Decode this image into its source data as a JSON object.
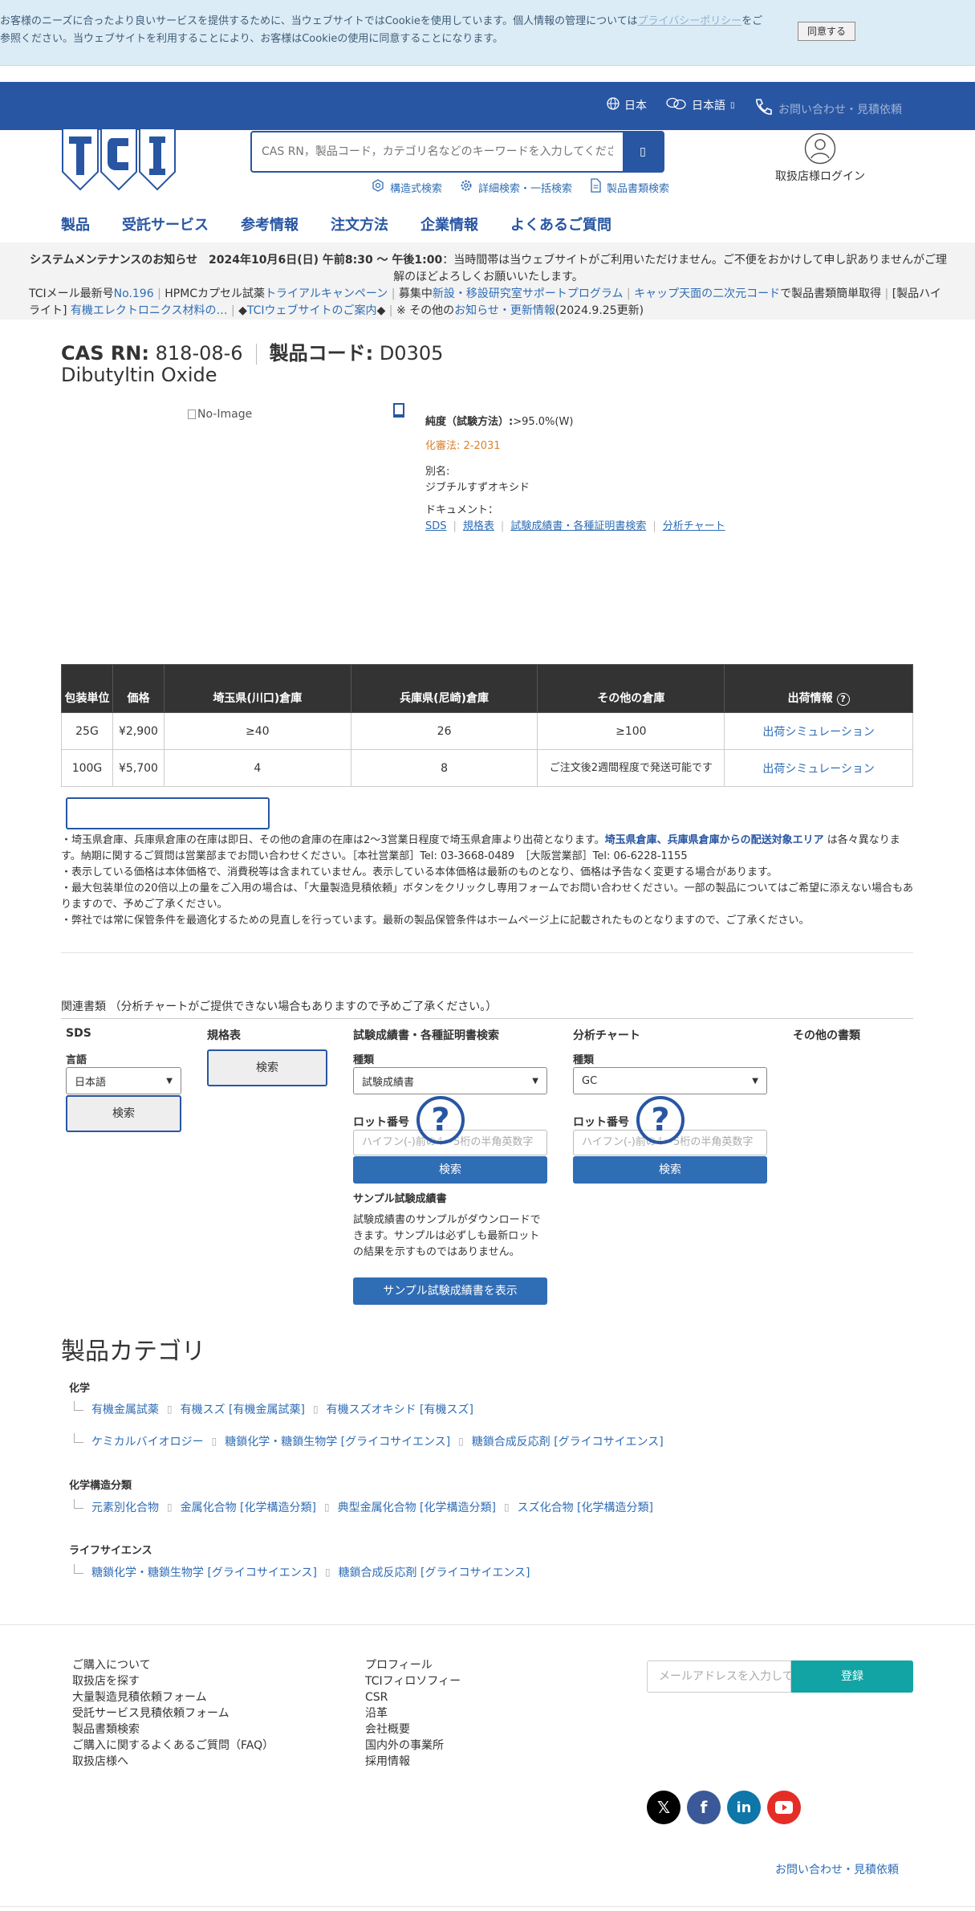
{
  "cookie": {
    "message_part1": "お客様のニーズに合ったより良いサービスを提供するために、当ウェブサイトではCookieを使用しています。個人情報の管理については",
    "privacy_link": "プライバシーポリシー",
    "message_part2": "をご参照ください。当ウェブサイトを利用することにより、お客様はCookieの使用に同意することになります。",
    "agree_label": "同意する"
  },
  "topbar": {
    "country": "日本",
    "language": "日本語",
    "contact": "お問い合わせ・見積依頼"
  },
  "header": {
    "search_placeholder": "CAS RN，製品コード，カテゴリ名などのキーワードを入力してください",
    "structure_search": "構造式検索",
    "advanced_search": "詳細検索・一括検索",
    "catalog_search": "製品書類検索",
    "login_label": "取扱店様ログイン"
  },
  "nav": [
    "製品",
    "受託サービス",
    "参考情報",
    "注文方法",
    "企業情報",
    "よくあるご質問"
  ],
  "notice": {
    "line1_bold": "システムメンテナンスのお知らせ　2024年10月6日(日) 午前8:30 〜 午後1:00",
    "line1_rest": "：当時間帯は当ウェブサイトがご利用いただけません。ご不便をおかけして申し訳ありませんがご理解のほどよろしくお願いいたします。",
    "line2_prefix": "TCIメール最新号",
    "line2_no": "No.196",
    "line2_a": "HPMCカプセル試薬",
    "line2_a_link": "トライアルキャンペーン",
    "line2_b": "募集中",
    "line2_b_link": "新設・移設研究室サポートプログラム",
    "line2_c_link": "キャップ天面の二次元コード",
    "line2_c": "で製品書類簡単取得",
    "line2_d": "[製品ハイライト]",
    "line2_d_link": "有機エレクトロニクス材料の…",
    "line2_e": "◆",
    "line2_e_link": "TCIウェブサイトのご案内",
    "line2_f": "◆",
    "line2_g": "※ その他の",
    "line2_g_link": "お知らせ・更新情報",
    "line2_h": "(2024.9.25更新)"
  },
  "product": {
    "cas_label": "CAS RN:",
    "cas": "818-08-6",
    "code_label": "製品コード:",
    "code": "D0305",
    "name": "Dibutyltin Oxide",
    "no_image": "No-Image",
    "purity_label": "純度（試験方法）:",
    "purity": ">95.0%(W)",
    "kashinho": "化審法:  2-2031",
    "alias_label": "別名:",
    "alias": "ジブチルすずオキシド",
    "doc_label": "ドキュメント：",
    "docs": [
      "SDS",
      "規格表",
      "試験成績書・各種証明書検索",
      "分析チャート"
    ]
  },
  "table": {
    "headers": [
      "包装単位",
      "価格",
      "埼玉県(川口)倉庫",
      "兵庫県(尼崎)倉庫",
      "その他の倉庫",
      "出荷情報"
    ],
    "rows": [
      [
        "25G",
        "¥2,900",
        "≥40",
        "26",
        "≥100",
        "出荷シミュレーション"
      ],
      [
        "100G",
        "¥5,700",
        "4",
        "8",
        "ご注文後2週間程度で発送可能です",
        "出荷シミュレーション"
      ]
    ]
  },
  "notes": {
    "n1a": "・埼玉県倉庫、兵庫県倉庫の在庫は即日、その他の倉庫の在庫は2〜3営業日程度で埼玉県倉庫より出荷となります。",
    "n1b": "埼玉県倉庫、兵庫県倉庫からの配送対象エリア",
    "n1c": "は各々異なります。納期に関するご質問は営業部までお問い合わせください。［本社営業部］Tel: 03-3668-0489　［大阪営業部］Tel: 06-6228-1155",
    "n2": "・表示している価格は本体価格で、消費税等は含まれていません。表示している本体価格は最新のものとなり、価格は予告なく変更する場合があります。",
    "n3": "・最大包装単位の20倍以上の量をご入用の場合は、「大量製造見積依頼」ボタンをクリックし専用フォームでお問い合わせください。一部の製品についてはご希望に添えない場合もありますので、予めご了承ください。",
    "n4": "・弊社では常に保管条件を最適化するための見直しを行っています。最新の製品保管条件はホームページ上に記載されたものとなりますので、ご了承ください。"
  },
  "docs": {
    "title": "関連書類 （分析チャートがご提供できない場合もありますので予めご了承ください。）",
    "sds_title": "SDS",
    "lang_label": "言語",
    "lang_value": "日本語",
    "search": "検索",
    "spec_title": "規格表",
    "coa_title": "試験成績書・各種証明書検索",
    "type_label": "種類",
    "coa_type": "試験成績書",
    "lot_label": "ロット番号",
    "lot_placeholder": "ハイフン(-)前の4～5桁の半角英数字",
    "sample_title": "サンプル試験成績書",
    "sample_desc": "試験成績書のサンプルがダウンロードできます。サンプルは必ずしも最新ロットの結果を示すものではありません。",
    "sample_btn": "サンプル試験成績書を表示",
    "chart_title": "分析チャート",
    "chart_type": "GC",
    "other_title": "その他の書類"
  },
  "categories": {
    "title": "製品カテゴリ",
    "groups": [
      {
        "name": "化学",
        "rows": [
          [
            "有機金属試薬",
            "有機スズ [有機金属試薬]",
            "有機スズオキシド [有機スズ]"
          ],
          [
            "ケミカルバイオロジー",
            "糖鎖化学・糖鎖生物学 [グライコサイエンス]",
            "糖鎖合成反応剤 [グライコサイエンス]"
          ]
        ]
      },
      {
        "name": "化学構造分類",
        "rows": [
          [
            "元素別化合物",
            "金属化合物 [化学構造分類]",
            "典型金属化合物 [化学構造分類]",
            "スズ化合物 [化学構造分類]"
          ]
        ]
      },
      {
        "name": "ライフサイエンス",
        "rows": [
          [
            "糖鎖化学・糖鎖生物学 [グライコサイエンス]",
            "糖鎖合成反応剤 [グライコサイエンス]"
          ]
        ]
      }
    ]
  },
  "footer": {
    "col1": [
      "ご購入について",
      "取扱店を探す",
      "大量製造見積依頼フォーム",
      "受託サービス見積依頼フォーム",
      "製品書類検索",
      "ご購入に関するよくあるご質問（FAQ）",
      "取扱店様へ"
    ],
    "col2": [
      "プロフィール",
      "TCIフィロソフィー",
      "CSR",
      "沿革",
      "会社概要",
      "国内外の事業所",
      "採用情報"
    ],
    "email_placeholder": "メールアドレスを入力してください",
    "register": "登録",
    "contact": "お問い合わせ・見積依頼",
    "colors": {
      "x": "#000000",
      "facebook": "#3b5998",
      "linkedin": "#0e76a8",
      "youtube": "#e52d27"
    }
  }
}
